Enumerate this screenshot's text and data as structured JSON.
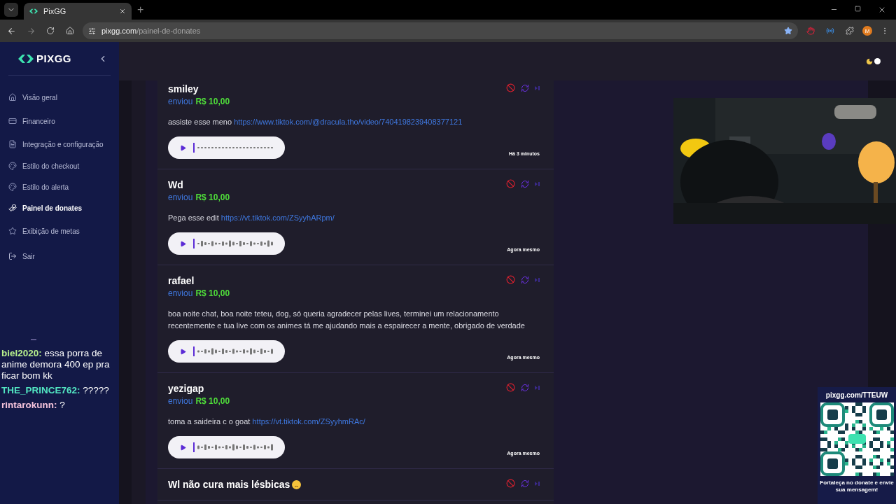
{
  "browser": {
    "tab_title": "PixGG",
    "new_tab": "+",
    "url_host": "pixgg.com",
    "url_path": "/painel-de-donates",
    "avatar": "M"
  },
  "sidebar": {
    "logo": "PIXGG",
    "items": [
      {
        "label": "Visão geral",
        "selected": false
      },
      {
        "label": "Financeiro",
        "selected": false
      },
      {
        "label": "Integração e configuração",
        "selected": false
      },
      {
        "label": "Estilo do checkout",
        "selected": false
      },
      {
        "label": "Estilo do alerta",
        "selected": false
      },
      {
        "label": "Painel de donates",
        "selected": true
      },
      {
        "label": "Exibição de metas",
        "selected": false
      }
    ],
    "logout": "Sair"
  },
  "donations": [
    {
      "name": "smiley",
      "verb": "enviou",
      "amount": "R$ 10,00",
      "message": "assiste esse meno",
      "link": "https://www.tiktok.com/@dracula.tho/video/7404198239408377121",
      "time": "Há 3 minutos"
    },
    {
      "name": "Wd",
      "verb": "enviou",
      "amount": "R$ 10,00",
      "message": "Pega esse edit",
      "link": "https://vt.tiktok.com/ZSyyhARpm/",
      "time": "Agora mesmo"
    },
    {
      "name": "rafael",
      "verb": "enviou",
      "amount": "R$ 10,00",
      "message": "boa noite chat, boa noite teteu, dog, só queria agradecer pelas lives, terminei um relacionamento recentemente e tua live com os animes tá me ajudando mais a espairecer a mente, obrigado de verdade",
      "time": "Agora mesmo"
    },
    {
      "name": "yezigap",
      "verb": "enviou",
      "amount": "R$ 10,00",
      "message": "toma a saideira c o goat",
      "link": "https://vt.tiktok.com/ZSyyhmRAc/",
      "time": "Agora mesmo"
    },
    {
      "name": "Wl não cura mais lésbicas"
    }
  ],
  "chat": [
    {
      "user": "biel2020:",
      "text": "essa porra de anime demora 400 ep pra ficar bom kk",
      "color": "#b6ef8c"
    },
    {
      "user": "THE_PRINCE762:",
      "text": "?????",
      "color": "#52e6c2"
    },
    {
      "user": "rintarokunn:",
      "text": "?",
      "color": "#f4c3db"
    }
  ],
  "qr": {
    "url": "pixgg.com/TTEUW",
    "caption": "Fortaleça no donate e envie sua mensagem!"
  }
}
